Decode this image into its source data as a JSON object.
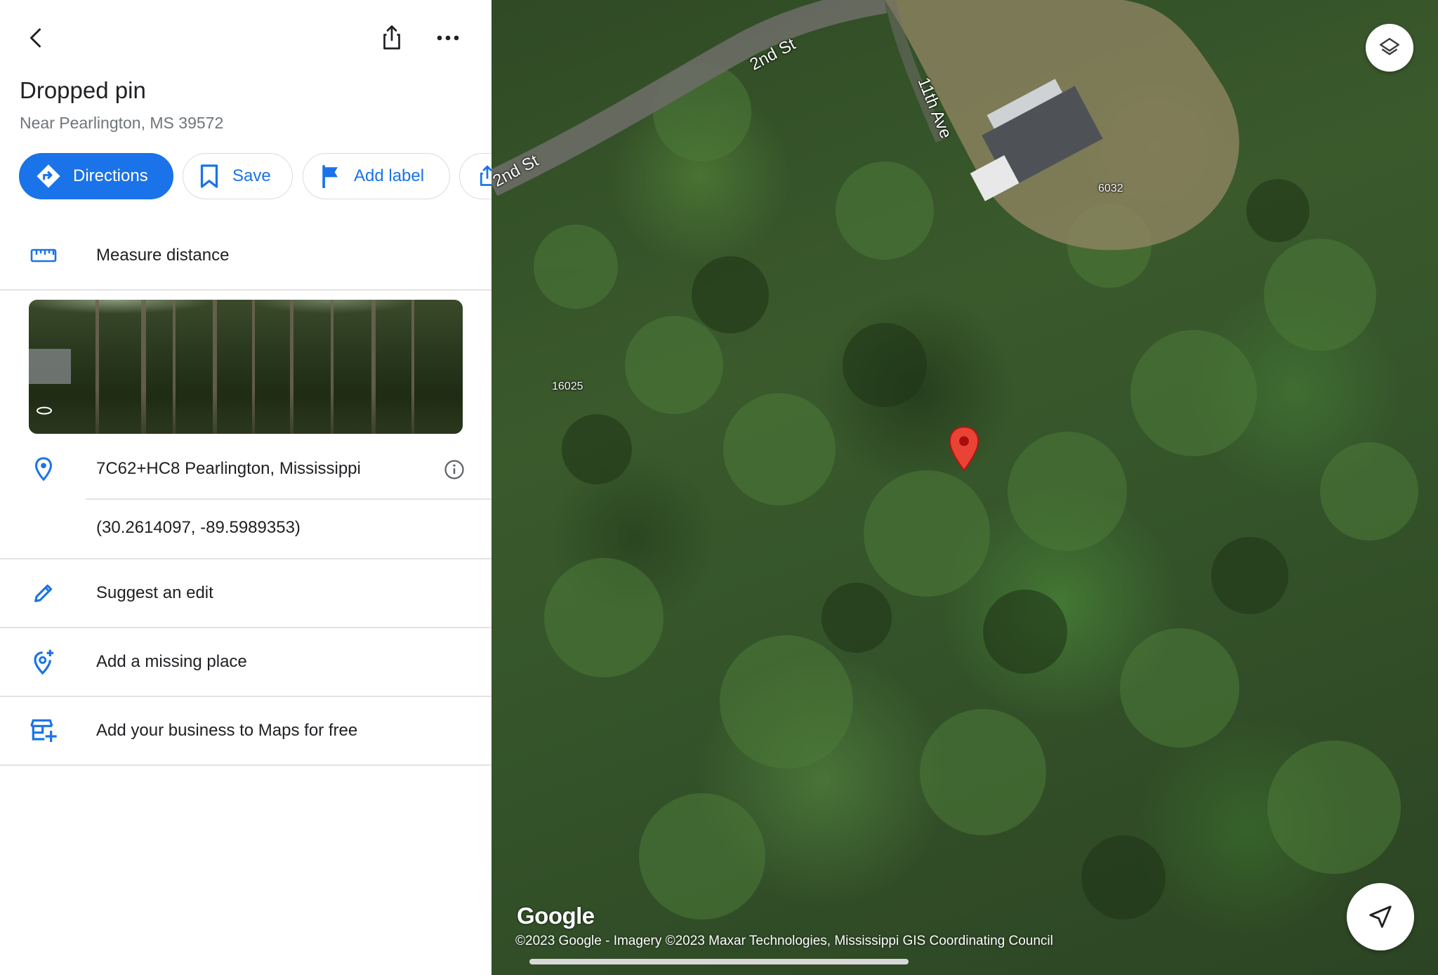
{
  "place": {
    "title": "Dropped pin",
    "subtitle": "Near Pearlington, MS 39572"
  },
  "actions": {
    "directions": "Directions",
    "save": "Save",
    "add_label": "Add label"
  },
  "rows": {
    "measure": "Measure distance",
    "plus_code": "7C62+HC8 Pearlington, Mississippi",
    "coordinates": "(30.2614097, -89.5989353)",
    "suggest_edit": "Suggest an edit",
    "add_missing_place": "Add a missing place",
    "add_business": "Add your business to Maps for free"
  },
  "map": {
    "labels": {
      "second_st_top": "2nd St",
      "second_st_left": "2nd St",
      "eleventh_ave": "11th Ave",
      "house_number": "6032",
      "lot_number": "16025"
    },
    "google_logo": "Google",
    "copyright": "©2023 Google - Imagery ©2023 Maxar Technologies, Mississippi GIS Coordinating Council"
  },
  "colors": {
    "accent": "#1a73e8",
    "pin": "#ea4335"
  }
}
